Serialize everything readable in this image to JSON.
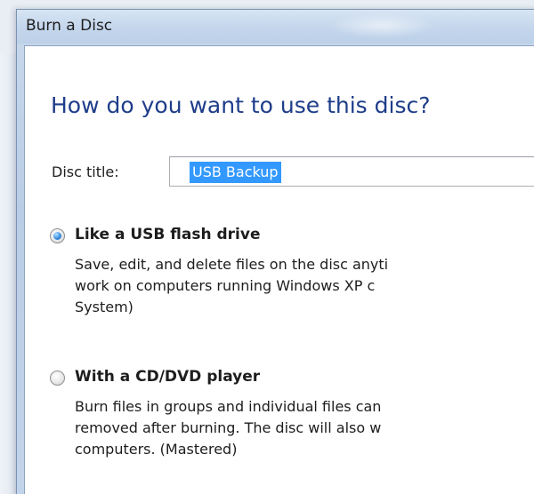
{
  "window": {
    "title": "Burn a Disc"
  },
  "main": {
    "heading": "How do you want to use this disc?",
    "disc_title_label": "Disc title:",
    "disc_title_value": "USB Backup",
    "options": [
      {
        "title": "Like a USB flash drive",
        "selected": true,
        "description": [
          "Save, edit, and delete files on the disc anyti",
          "work on computers running Windows XP c",
          "System)"
        ]
      },
      {
        "title": "With a CD/DVD player",
        "selected": false,
        "description": [
          "Burn files in groups and individual files can",
          "removed after burning. The disc will also w",
          "computers. (Mastered)"
        ]
      }
    ]
  },
  "colors": {
    "heading": "#1e3d8a",
    "selection": "#3399ff"
  }
}
